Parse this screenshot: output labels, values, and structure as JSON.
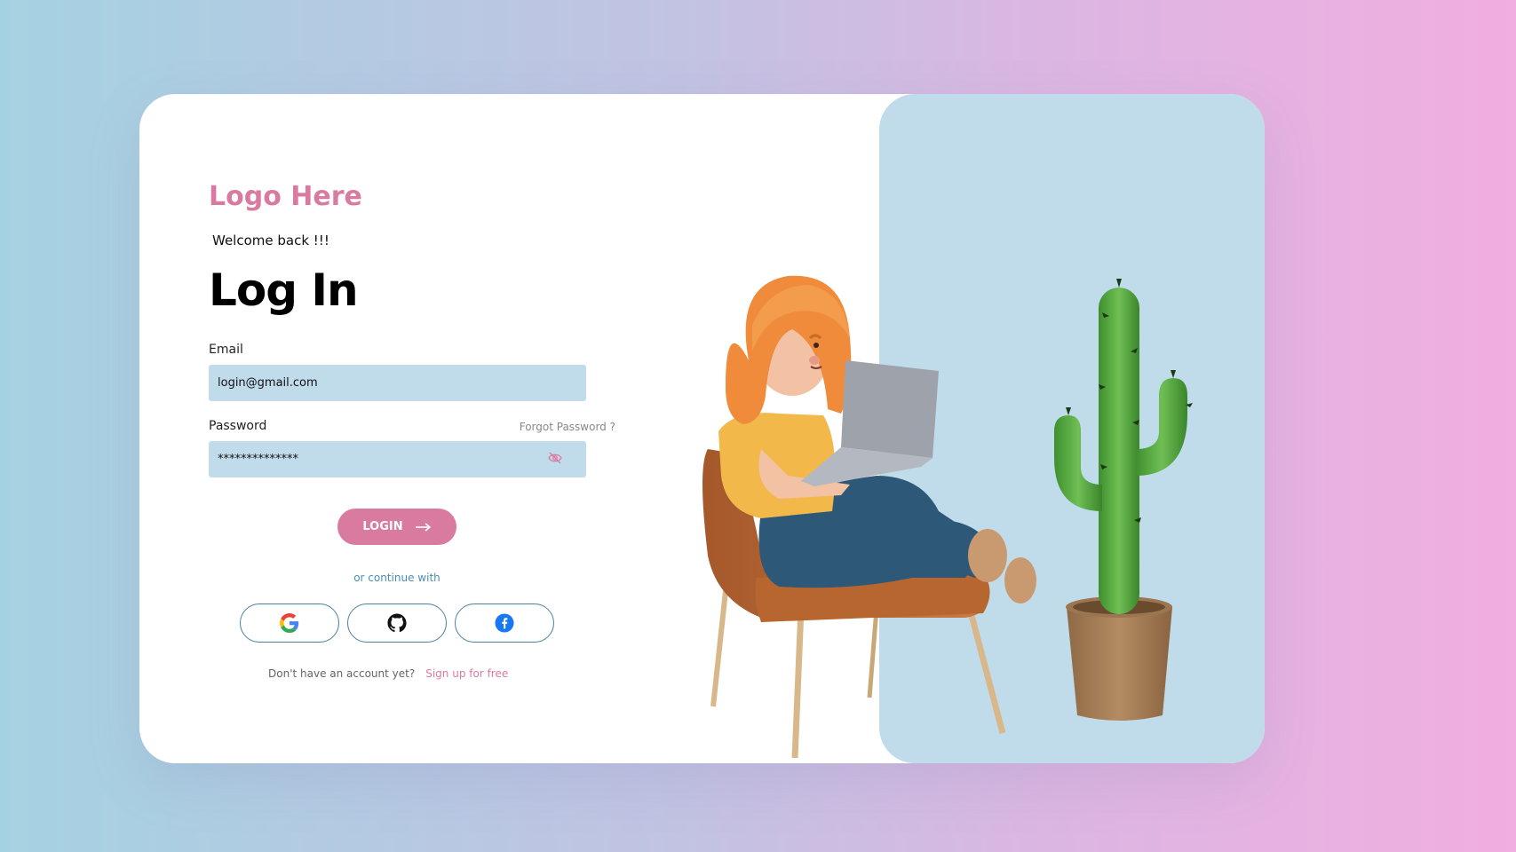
{
  "brand": {
    "logo_text": "Logo Here"
  },
  "login": {
    "welcome": "Welcome back !!!",
    "title": "Log In",
    "email_label": "Email",
    "email_value": "login@gmail.com",
    "password_label": "Password",
    "forgot_label": "Forgot Password ?",
    "password_value": "**************",
    "login_button": "LOGIN",
    "or_text": "or continue with",
    "no_account_text": "Don't have an account yet?",
    "signup_link": "Sign up for free"
  },
  "social": [
    {
      "name": "google",
      "icon": "google-icon"
    },
    {
      "name": "github",
      "icon": "github-icon"
    },
    {
      "name": "facebook",
      "icon": "facebook-icon"
    }
  ],
  "colors": {
    "accent": "#d97ba0",
    "input_bg": "#c0dceb",
    "panel_bg": "#c0dceb",
    "link_blue": "#4a8fb5"
  }
}
